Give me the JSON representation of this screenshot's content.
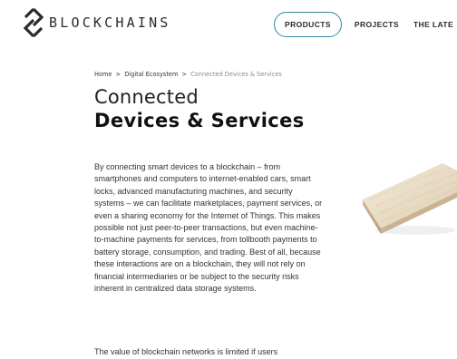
{
  "header": {
    "logo_text": "BLOCKCHAINS",
    "nav": {
      "products": "PRODUCTS",
      "projects": "PROJECTS",
      "the_latest": "THE LATE"
    }
  },
  "breadcrumb": {
    "home": "Home",
    "separator": ">",
    "section": "Digital Ecosystem",
    "current": "Connected Devices & Services"
  },
  "title": {
    "line1": "Connected",
    "line2": "Devices & Services"
  },
  "body": {
    "paragraph1": "By connecting smart devices to a blockchain – from smartphones and computers to internet-enabled cars, smart locks, advanced manufacturing machines, and security systems – we can facilitate marketplaces, payment services, or even a sharing economy for the Internet of Things. This makes possible not just peer-to-peer transactions, but even machine-to-machine payments for services, from tollbooth payments to battery storage, consumption, and trading. Best of all, because these interactions are on a blockchain, they will not rely on financial intermediaries or be subject to the security risks inherent in centralized data storage systems.",
    "paragraph2": "The value of blockchain networks is limited if users"
  },
  "colors": {
    "accent": "#2f8a9a",
    "text": "#333333"
  },
  "icons": {
    "logo": "diamond-logo-icon"
  }
}
